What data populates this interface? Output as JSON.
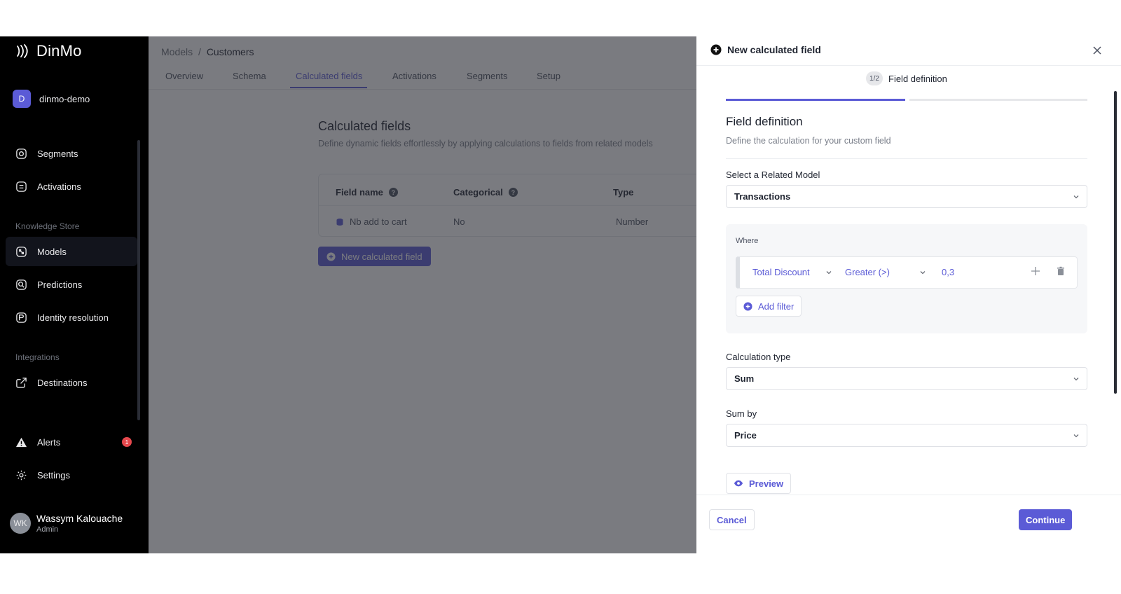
{
  "app": {
    "logo_text": "DinMo"
  },
  "sidebar": {
    "workspace": {
      "initial": "D",
      "name": "dinmo-demo"
    },
    "items_top": [
      {
        "label": "Segments",
        "icon": "segments-icon"
      },
      {
        "label": "Activations",
        "icon": "activations-icon"
      }
    ],
    "section_knowledge": "Knowledge Store",
    "items_knowledge": [
      {
        "label": "Models",
        "icon": "models-icon",
        "active": true
      },
      {
        "label": "Predictions",
        "icon": "predictions-icon"
      },
      {
        "label": "Identity resolution",
        "icon": "identity-resolution-icon"
      }
    ],
    "section_integrations": "Integrations",
    "items_integrations": [
      {
        "label": "Destinations",
        "icon": "destinations-icon"
      }
    ],
    "alerts": {
      "label": "Alerts",
      "badge": "1"
    },
    "settings": {
      "label": "Settings"
    },
    "user": {
      "initials": "WK",
      "name": "Wassym Kalouache",
      "role": "Admin"
    }
  },
  "main": {
    "breadcrumb": {
      "parent": "Models",
      "separator": "/",
      "current": "Customers"
    },
    "tabs": [
      "Overview",
      "Schema",
      "Calculated fields",
      "Activations",
      "Segments",
      "Setup"
    ],
    "active_tab": "Calculated fields",
    "section_title": "Calculated fields",
    "section_desc": "Define dynamic fields effortlessly by applying calculations to fields from related models",
    "table": {
      "headers": [
        "Field name",
        "Categorical",
        "Type"
      ],
      "rows": [
        {
          "field_name": "Nb add to cart",
          "categorical": "No",
          "type": "Number"
        }
      ]
    },
    "new_button": "New calculated field"
  },
  "drawer": {
    "title": "New calculated field",
    "step": {
      "badge": "1/2",
      "label": "Field definition",
      "progress": 0.5
    },
    "heading": "Field definition",
    "description": "Define the calculation for your custom field",
    "related_model": {
      "label": "Select a Related Model",
      "value": "Transactions"
    },
    "where": {
      "label": "Where",
      "filter": {
        "field": "Total Discount",
        "operator": "Greater (>)",
        "value": "0,3"
      },
      "add_filter": "Add filter"
    },
    "calculation_type": {
      "label": "Calculation type",
      "value": "Sum"
    },
    "sum_by": {
      "label": "Sum by",
      "value": "Price"
    },
    "preview": "Preview",
    "cancel": "Cancel",
    "continue": "Continue"
  },
  "colors": {
    "accent": "#5b5bd6",
    "sidebar_bg": "#000000",
    "alert": "#e5484d"
  }
}
